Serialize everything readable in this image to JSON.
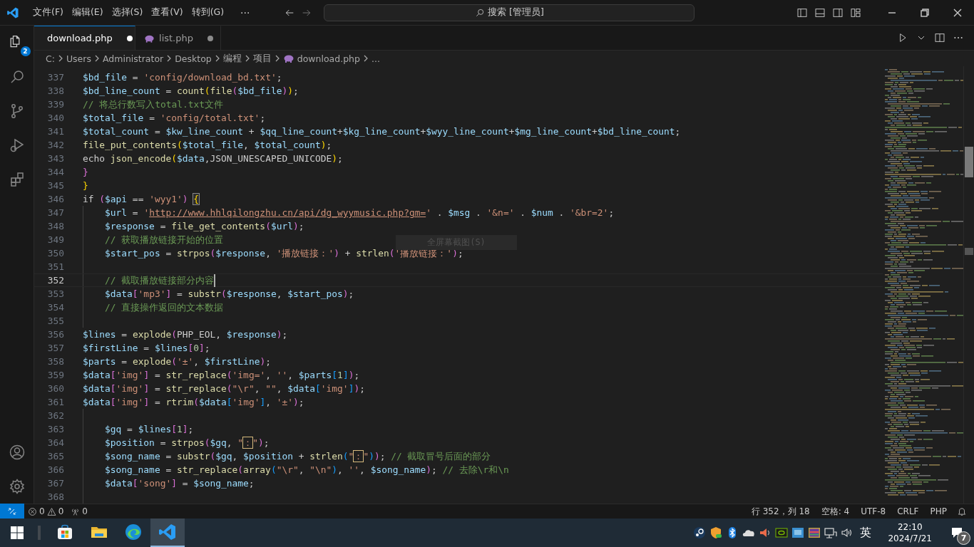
{
  "window": {
    "menu": [
      "文件(F)",
      "编辑(E)",
      "选择(S)",
      "查看(V)",
      "转到(G)"
    ],
    "more": "···",
    "search": "搜索 [管理员]"
  },
  "activity_bar": {
    "explorer_badge": "2"
  },
  "tabs": [
    {
      "label": "download.php",
      "selected": true,
      "modified": true
    },
    {
      "label": "list.php",
      "selected": false,
      "modified": true
    }
  ],
  "breadcrumb": [
    {
      "text": "C:",
      "kind": "folder"
    },
    {
      "text": "Users",
      "kind": "folder"
    },
    {
      "text": "Administrator",
      "kind": "folder"
    },
    {
      "text": "Desktop",
      "kind": "folder"
    },
    {
      "text": "编程",
      "kind": "folder"
    },
    {
      "text": "项目",
      "kind": "folder"
    },
    {
      "text": "download.php",
      "kind": "file"
    },
    {
      "text": "...",
      "kind": "folder"
    }
  ],
  "editor": {
    "tooltip": "全屏幕截图(S)",
    "lines": [
      {
        "number": "337",
        "indented": false,
        "current": false,
        "tokens": [
          {
            "kind": "var",
            "text": "$bd_file"
          },
          {
            "kind": "txt",
            "text": " = "
          },
          {
            "kind": "str",
            "text": "'config/download_bd.txt'"
          },
          {
            "kind": "txt",
            "text": ";"
          }
        ]
      },
      {
        "number": "338",
        "indented": false,
        "current": false,
        "tokens": [
          {
            "kind": "var",
            "text": "$bd_line_count"
          },
          {
            "kind": "txt",
            "text": " = "
          },
          {
            "kind": "fn",
            "text": "count"
          },
          {
            "kind": "gold",
            "text": "("
          },
          {
            "kind": "fn",
            "text": "file"
          },
          {
            "kind": "pink",
            "text": "("
          },
          {
            "kind": "var",
            "text": "$bd_file"
          },
          {
            "kind": "pink",
            "text": ")"
          },
          {
            "kind": "gold",
            "text": ")"
          },
          {
            "kind": "txt",
            "text": ";"
          }
        ]
      },
      {
        "number": "339",
        "indented": false,
        "current": false,
        "tokens": [
          {
            "kind": "cmt",
            "text": "// 将总行数写入total.txt文件"
          }
        ]
      },
      {
        "number": "340",
        "indented": false,
        "current": false,
        "tokens": [
          {
            "kind": "var",
            "text": "$total_file"
          },
          {
            "kind": "txt",
            "text": " = "
          },
          {
            "kind": "str",
            "text": "'config/total.txt'"
          },
          {
            "kind": "txt",
            "text": ";"
          }
        ]
      },
      {
        "number": "341",
        "indented": false,
        "current": false,
        "tokens": [
          {
            "kind": "var",
            "text": "$total_count"
          },
          {
            "kind": "txt",
            "text": " = "
          },
          {
            "kind": "var",
            "text": "$kw_line_count"
          },
          {
            "kind": "txt",
            "text": " + "
          },
          {
            "kind": "var",
            "text": "$qq_line_count"
          },
          {
            "kind": "txt",
            "text": "+"
          },
          {
            "kind": "var",
            "text": "$kg_line_count"
          },
          {
            "kind": "txt",
            "text": "+"
          },
          {
            "kind": "var",
            "text": "$wyy_line_count"
          },
          {
            "kind": "txt",
            "text": "+"
          },
          {
            "kind": "var",
            "text": "$mg_line_count"
          },
          {
            "kind": "txt",
            "text": "+"
          },
          {
            "kind": "var",
            "text": "$bd_line_count"
          },
          {
            "kind": "txt",
            "text": ";"
          }
        ]
      },
      {
        "number": "342",
        "indented": false,
        "current": false,
        "tokens": [
          {
            "kind": "fn",
            "text": "file_put_contents"
          },
          {
            "kind": "gold",
            "text": "("
          },
          {
            "kind": "var",
            "text": "$total_file"
          },
          {
            "kind": "txt",
            "text": ", "
          },
          {
            "kind": "var",
            "text": "$total_count"
          },
          {
            "kind": "gold",
            "text": ")"
          },
          {
            "kind": "txt",
            "text": ";"
          }
        ]
      },
      {
        "number": "343",
        "indented": false,
        "current": false,
        "tokens": [
          {
            "kind": "txt",
            "text": "echo "
          },
          {
            "kind": "fn",
            "text": "json_encode"
          },
          {
            "kind": "gold",
            "text": "("
          },
          {
            "kind": "var",
            "text": "$data"
          },
          {
            "kind": "txt",
            "text": ",JSON_UNESCAPED_UNICODE"
          },
          {
            "kind": "gold",
            "text": ")"
          },
          {
            "kind": "txt",
            "text": ";"
          }
        ]
      },
      {
        "number": "344",
        "indented": false,
        "current": false,
        "tokens": [
          {
            "kind": "pink",
            "text": "}"
          }
        ]
      },
      {
        "number": "345",
        "indented": false,
        "current": false,
        "tokens": [
          {
            "kind": "gold",
            "text": "}"
          }
        ]
      },
      {
        "number": "346",
        "indented": false,
        "current": false,
        "tokens": [
          {
            "kind": "txt",
            "text": "if "
          },
          {
            "kind": "pink",
            "text": "("
          },
          {
            "kind": "var",
            "text": "$api"
          },
          {
            "kind": "txt",
            "text": " == "
          },
          {
            "kind": "str",
            "text": "'wyy1'"
          },
          {
            "kind": "pink",
            "text": ") "
          },
          {
            "kind": "match",
            "text": "{"
          }
        ]
      },
      {
        "number": "347",
        "indented": true,
        "current": false,
        "tokens": [
          {
            "kind": "var",
            "text": "$url"
          },
          {
            "kind": "txt",
            "text": " = "
          },
          {
            "kind": "str",
            "text": "'"
          },
          {
            "kind": "url",
            "text": "http://www.hhlqilongzhu.cn/api/dg_wyymusic.php?gm="
          },
          {
            "kind": "str",
            "text": "'"
          },
          {
            "kind": "txt",
            "text": " . "
          },
          {
            "kind": "var",
            "text": "$msg"
          },
          {
            "kind": "txt",
            "text": " . "
          },
          {
            "kind": "str",
            "text": "'&n='"
          },
          {
            "kind": "txt",
            "text": " . "
          },
          {
            "kind": "var",
            "text": "$num"
          },
          {
            "kind": "txt",
            "text": " . "
          },
          {
            "kind": "str",
            "text": "'&br=2'"
          },
          {
            "kind": "txt",
            "text": ";"
          }
        ]
      },
      {
        "number": "348",
        "indented": true,
        "current": false,
        "tokens": [
          {
            "kind": "var",
            "text": "$response"
          },
          {
            "kind": "txt",
            "text": " = "
          },
          {
            "kind": "fn",
            "text": "file_get_contents"
          },
          {
            "kind": "pink",
            "text": "("
          },
          {
            "kind": "var",
            "text": "$url"
          },
          {
            "kind": "pink",
            "text": ")"
          },
          {
            "kind": "txt",
            "text": ";"
          }
        ]
      },
      {
        "number": "349",
        "indented": true,
        "current": false,
        "tokens": [
          {
            "kind": "cmt",
            "text": "// 获取播放链接开始的位置"
          }
        ]
      },
      {
        "number": "350",
        "indented": true,
        "current": false,
        "tokens": [
          {
            "kind": "var",
            "text": "$start_pos"
          },
          {
            "kind": "txt",
            "text": " = "
          },
          {
            "kind": "fn",
            "text": "strpos"
          },
          {
            "kind": "pink",
            "text": "("
          },
          {
            "kind": "var",
            "text": "$response"
          },
          {
            "kind": "txt",
            "text": ", "
          },
          {
            "kind": "str",
            "text": "'播放链接：'"
          },
          {
            "kind": "pink",
            "text": ")"
          },
          {
            "kind": "txt",
            "text": " + "
          },
          {
            "kind": "fn",
            "text": "strlen"
          },
          {
            "kind": "pink",
            "text": "("
          },
          {
            "kind": "str",
            "text": "'播放链接：'"
          },
          {
            "kind": "pink",
            "text": ")"
          },
          {
            "kind": "txt",
            "text": ";"
          }
        ]
      },
      {
        "number": "351",
        "indented": true,
        "current": false
      },
      {
        "number": "352",
        "indented": true,
        "current": true,
        "tokens": [
          {
            "kind": "cmt",
            "text": "// 截取播放链接部分内容"
          }
        ]
      },
      {
        "number": "353",
        "indented": true,
        "current": false,
        "tokens": [
          {
            "kind": "var",
            "text": "$data"
          },
          {
            "kind": "pink",
            "text": "["
          },
          {
            "kind": "str",
            "text": "'mp3'"
          },
          {
            "kind": "pink",
            "text": "]"
          },
          {
            "kind": "txt",
            "text": " = "
          },
          {
            "kind": "fn",
            "text": "substr"
          },
          {
            "kind": "pink",
            "text": "("
          },
          {
            "kind": "var",
            "text": "$response"
          },
          {
            "kind": "txt",
            "text": ", "
          },
          {
            "kind": "var",
            "text": "$start_pos"
          },
          {
            "kind": "pink",
            "text": ")"
          },
          {
            "kind": "txt",
            "text": ";"
          }
        ]
      },
      {
        "number": "354",
        "indented": true,
        "current": false,
        "tokens": [
          {
            "kind": "cmt",
            "text": "// 直接操作返回的文本数据"
          }
        ]
      },
      {
        "number": "355",
        "indented": true,
        "current": false
      },
      {
        "number": "356",
        "indented": false,
        "current": false,
        "tokens": [
          {
            "kind": "var",
            "text": "$lines"
          },
          {
            "kind": "txt",
            "text": " = "
          },
          {
            "kind": "fn",
            "text": "explode"
          },
          {
            "kind": "pink",
            "text": "("
          },
          {
            "kind": "txt",
            "text": "PHP_EOL, "
          },
          {
            "kind": "var",
            "text": "$response"
          },
          {
            "kind": "pink",
            "text": ")"
          },
          {
            "kind": "txt",
            "text": ";"
          }
        ]
      },
      {
        "number": "357",
        "indented": false,
        "current": false,
        "tokens": [
          {
            "kind": "var",
            "text": "$firstLine"
          },
          {
            "kind": "txt",
            "text": " = "
          },
          {
            "kind": "var",
            "text": "$lines"
          },
          {
            "kind": "pink",
            "text": "["
          },
          {
            "kind": "num",
            "text": "0"
          },
          {
            "kind": "pink",
            "text": "]"
          },
          {
            "kind": "txt",
            "text": ";"
          }
        ]
      },
      {
        "number": "358",
        "indented": false,
        "current": false,
        "tokens": [
          {
            "kind": "var",
            "text": "$parts"
          },
          {
            "kind": "txt",
            "text": " = "
          },
          {
            "kind": "fn",
            "text": "explode"
          },
          {
            "kind": "pink",
            "text": "("
          },
          {
            "kind": "str",
            "text": "'±'"
          },
          {
            "kind": "txt",
            "text": ", "
          },
          {
            "kind": "var",
            "text": "$firstLine"
          },
          {
            "kind": "pink",
            "text": ")"
          },
          {
            "kind": "txt",
            "text": ";"
          }
        ]
      },
      {
        "number": "359",
        "indented": false,
        "current": false,
        "tokens": [
          {
            "kind": "var",
            "text": "$data"
          },
          {
            "kind": "pink",
            "text": "["
          },
          {
            "kind": "str",
            "text": "'img'"
          },
          {
            "kind": "pink",
            "text": "]"
          },
          {
            "kind": "txt",
            "text": " = "
          },
          {
            "kind": "fn",
            "text": "str_replace"
          },
          {
            "kind": "pink",
            "text": "("
          },
          {
            "kind": "str",
            "text": "'img='"
          },
          {
            "kind": "txt",
            "text": ", "
          },
          {
            "kind": "str",
            "text": "''"
          },
          {
            "kind": "txt",
            "text": ", "
          },
          {
            "kind": "var",
            "text": "$parts"
          },
          {
            "kind": "blue",
            "text": "["
          },
          {
            "kind": "num",
            "text": "1"
          },
          {
            "kind": "blue",
            "text": "]"
          },
          {
            "kind": "pink",
            "text": ")"
          },
          {
            "kind": "txt",
            "text": ";"
          }
        ]
      },
      {
        "number": "360",
        "indented": false,
        "current": false,
        "tokens": [
          {
            "kind": "var",
            "text": "$data"
          },
          {
            "kind": "pink",
            "text": "["
          },
          {
            "kind": "str",
            "text": "'img'"
          },
          {
            "kind": "pink",
            "text": "]"
          },
          {
            "kind": "txt",
            "text": " = "
          },
          {
            "kind": "fn",
            "text": "str_replace"
          },
          {
            "kind": "pink",
            "text": "("
          },
          {
            "kind": "str",
            "text": "\"\\r\""
          },
          {
            "kind": "txt",
            "text": ", "
          },
          {
            "kind": "str",
            "text": "\"\""
          },
          {
            "kind": "txt",
            "text": ", "
          },
          {
            "kind": "var",
            "text": "$data"
          },
          {
            "kind": "blue",
            "text": "["
          },
          {
            "kind": "str",
            "text": "'img'"
          },
          {
            "kind": "blue",
            "text": "]"
          },
          {
            "kind": "pink",
            "text": ")"
          },
          {
            "kind": "txt",
            "text": ";"
          }
        ]
      },
      {
        "number": "361",
        "indented": false,
        "current": false,
        "tokens": [
          {
            "kind": "var",
            "text": "$data"
          },
          {
            "kind": "pink",
            "text": "["
          },
          {
            "kind": "str",
            "text": "'img'"
          },
          {
            "kind": "pink",
            "text": "]"
          },
          {
            "kind": "txt",
            "text": " = "
          },
          {
            "kind": "fn",
            "text": "rtrim"
          },
          {
            "kind": "pink",
            "text": "("
          },
          {
            "kind": "var",
            "text": "$data"
          },
          {
            "kind": "blue",
            "text": "["
          },
          {
            "kind": "str",
            "text": "'img'"
          },
          {
            "kind": "blue",
            "text": "]"
          },
          {
            "kind": "txt",
            "text": ", "
          },
          {
            "kind": "str",
            "text": "'±'"
          },
          {
            "kind": "pink",
            "text": ")"
          },
          {
            "kind": "txt",
            "text": ";"
          }
        ]
      },
      {
        "number": "362",
        "indented": true,
        "current": false
      },
      {
        "number": "363",
        "indented": true,
        "current": false,
        "tokens": [
          {
            "kind": "var",
            "text": "$gq"
          },
          {
            "kind": "txt",
            "text": " = "
          },
          {
            "kind": "var",
            "text": "$lines"
          },
          {
            "kind": "pink",
            "text": "["
          },
          {
            "kind": "num",
            "text": "1"
          },
          {
            "kind": "pink",
            "text": "]"
          },
          {
            "kind": "txt",
            "text": ";"
          }
        ]
      },
      {
        "number": "364",
        "indented": true,
        "current": false,
        "tokens": [
          {
            "kind": "var",
            "text": "$position"
          },
          {
            "kind": "txt",
            "text": " = "
          },
          {
            "kind": "fn",
            "text": "strpos"
          },
          {
            "kind": "pink",
            "text": "("
          },
          {
            "kind": "var",
            "text": "$gq"
          },
          {
            "kind": "txt",
            "text": ", "
          },
          {
            "kind": "str",
            "text": "\""
          },
          {
            "kind": "boxed",
            "text": "："
          },
          {
            "kind": "str",
            "text": "\""
          },
          {
            "kind": "pink",
            "text": ")"
          },
          {
            "kind": "txt",
            "text": ";"
          }
        ]
      },
      {
        "number": "365",
        "indented": true,
        "current": false,
        "tokens": [
          {
            "kind": "var",
            "text": "$song_name"
          },
          {
            "kind": "txt",
            "text": " = "
          },
          {
            "kind": "fn",
            "text": "substr"
          },
          {
            "kind": "pink",
            "text": "("
          },
          {
            "kind": "var",
            "text": "$gq"
          },
          {
            "kind": "txt",
            "text": ", "
          },
          {
            "kind": "var",
            "text": "$position"
          },
          {
            "kind": "txt",
            "text": " + "
          },
          {
            "kind": "fn",
            "text": "strlen"
          },
          {
            "kind": "blue",
            "text": "("
          },
          {
            "kind": "str",
            "text": "\""
          },
          {
            "kind": "boxed",
            "text": "："
          },
          {
            "kind": "str",
            "text": "\""
          },
          {
            "kind": "blue",
            "text": ")"
          },
          {
            "kind": "pink",
            "text": ")"
          },
          {
            "kind": "txt",
            "text": "; "
          },
          {
            "kind": "cmt",
            "text": "// 截取冒号后面的部分"
          }
        ]
      },
      {
        "number": "366",
        "indented": true,
        "current": false,
        "tokens": [
          {
            "kind": "var",
            "text": "$song_name"
          },
          {
            "kind": "txt",
            "text": " = "
          },
          {
            "kind": "fn",
            "text": "str_replace"
          },
          {
            "kind": "pink",
            "text": "("
          },
          {
            "kind": "fn",
            "text": "array"
          },
          {
            "kind": "blue",
            "text": "("
          },
          {
            "kind": "str",
            "text": "\"\\r\""
          },
          {
            "kind": "txt",
            "text": ", "
          },
          {
            "kind": "str",
            "text": "\"\\n\""
          },
          {
            "kind": "blue",
            "text": ")"
          },
          {
            "kind": "txt",
            "text": ", "
          },
          {
            "kind": "str",
            "text": "''"
          },
          {
            "kind": "txt",
            "text": ", "
          },
          {
            "kind": "var",
            "text": "$song_name"
          },
          {
            "kind": "pink",
            "text": ")"
          },
          {
            "kind": "txt",
            "text": "; "
          },
          {
            "kind": "cmt",
            "text": "// 去除\\r和\\n"
          }
        ]
      },
      {
        "number": "367",
        "indented": true,
        "current": false,
        "tokens": [
          {
            "kind": "var",
            "text": "$data"
          },
          {
            "kind": "pink",
            "text": "["
          },
          {
            "kind": "str",
            "text": "'song'"
          },
          {
            "kind": "pink",
            "text": "]"
          },
          {
            "kind": "txt",
            "text": " = "
          },
          {
            "kind": "var",
            "text": "$song_name"
          },
          {
            "kind": "txt",
            "text": ";"
          }
        ]
      },
      {
        "number": "368",
        "indented": true,
        "current": false
      }
    ]
  },
  "status_bar": {
    "errors": "0",
    "warnings": "0",
    "ports": "0",
    "position": "行 352，列 18",
    "indent": "空格: 4",
    "encoding": "UTF-8",
    "eol": "CRLF",
    "language": "PHP"
  },
  "taskbar": {
    "apps": [
      {
        "kind": "store",
        "selected": false
      },
      {
        "kind": "files",
        "selected": false
      },
      {
        "kind": "browser",
        "selected": false
      },
      {
        "kind": "editor",
        "selected": true
      }
    ],
    "tray": [
      {
        "kind": "steam"
      },
      {
        "kind": "shield"
      },
      {
        "kind": "bluetooth"
      },
      {
        "kind": "cloud"
      },
      {
        "kind": "speaker"
      },
      {
        "kind": "gpu"
      },
      {
        "kind": "monitor"
      },
      {
        "kind": "palette"
      },
      {
        "kind": "network"
      },
      {
        "kind": "volume"
      }
    ],
    "ime": "英",
    "time": "22:10",
    "date": "2024/7/21",
    "notifications": "7"
  }
}
